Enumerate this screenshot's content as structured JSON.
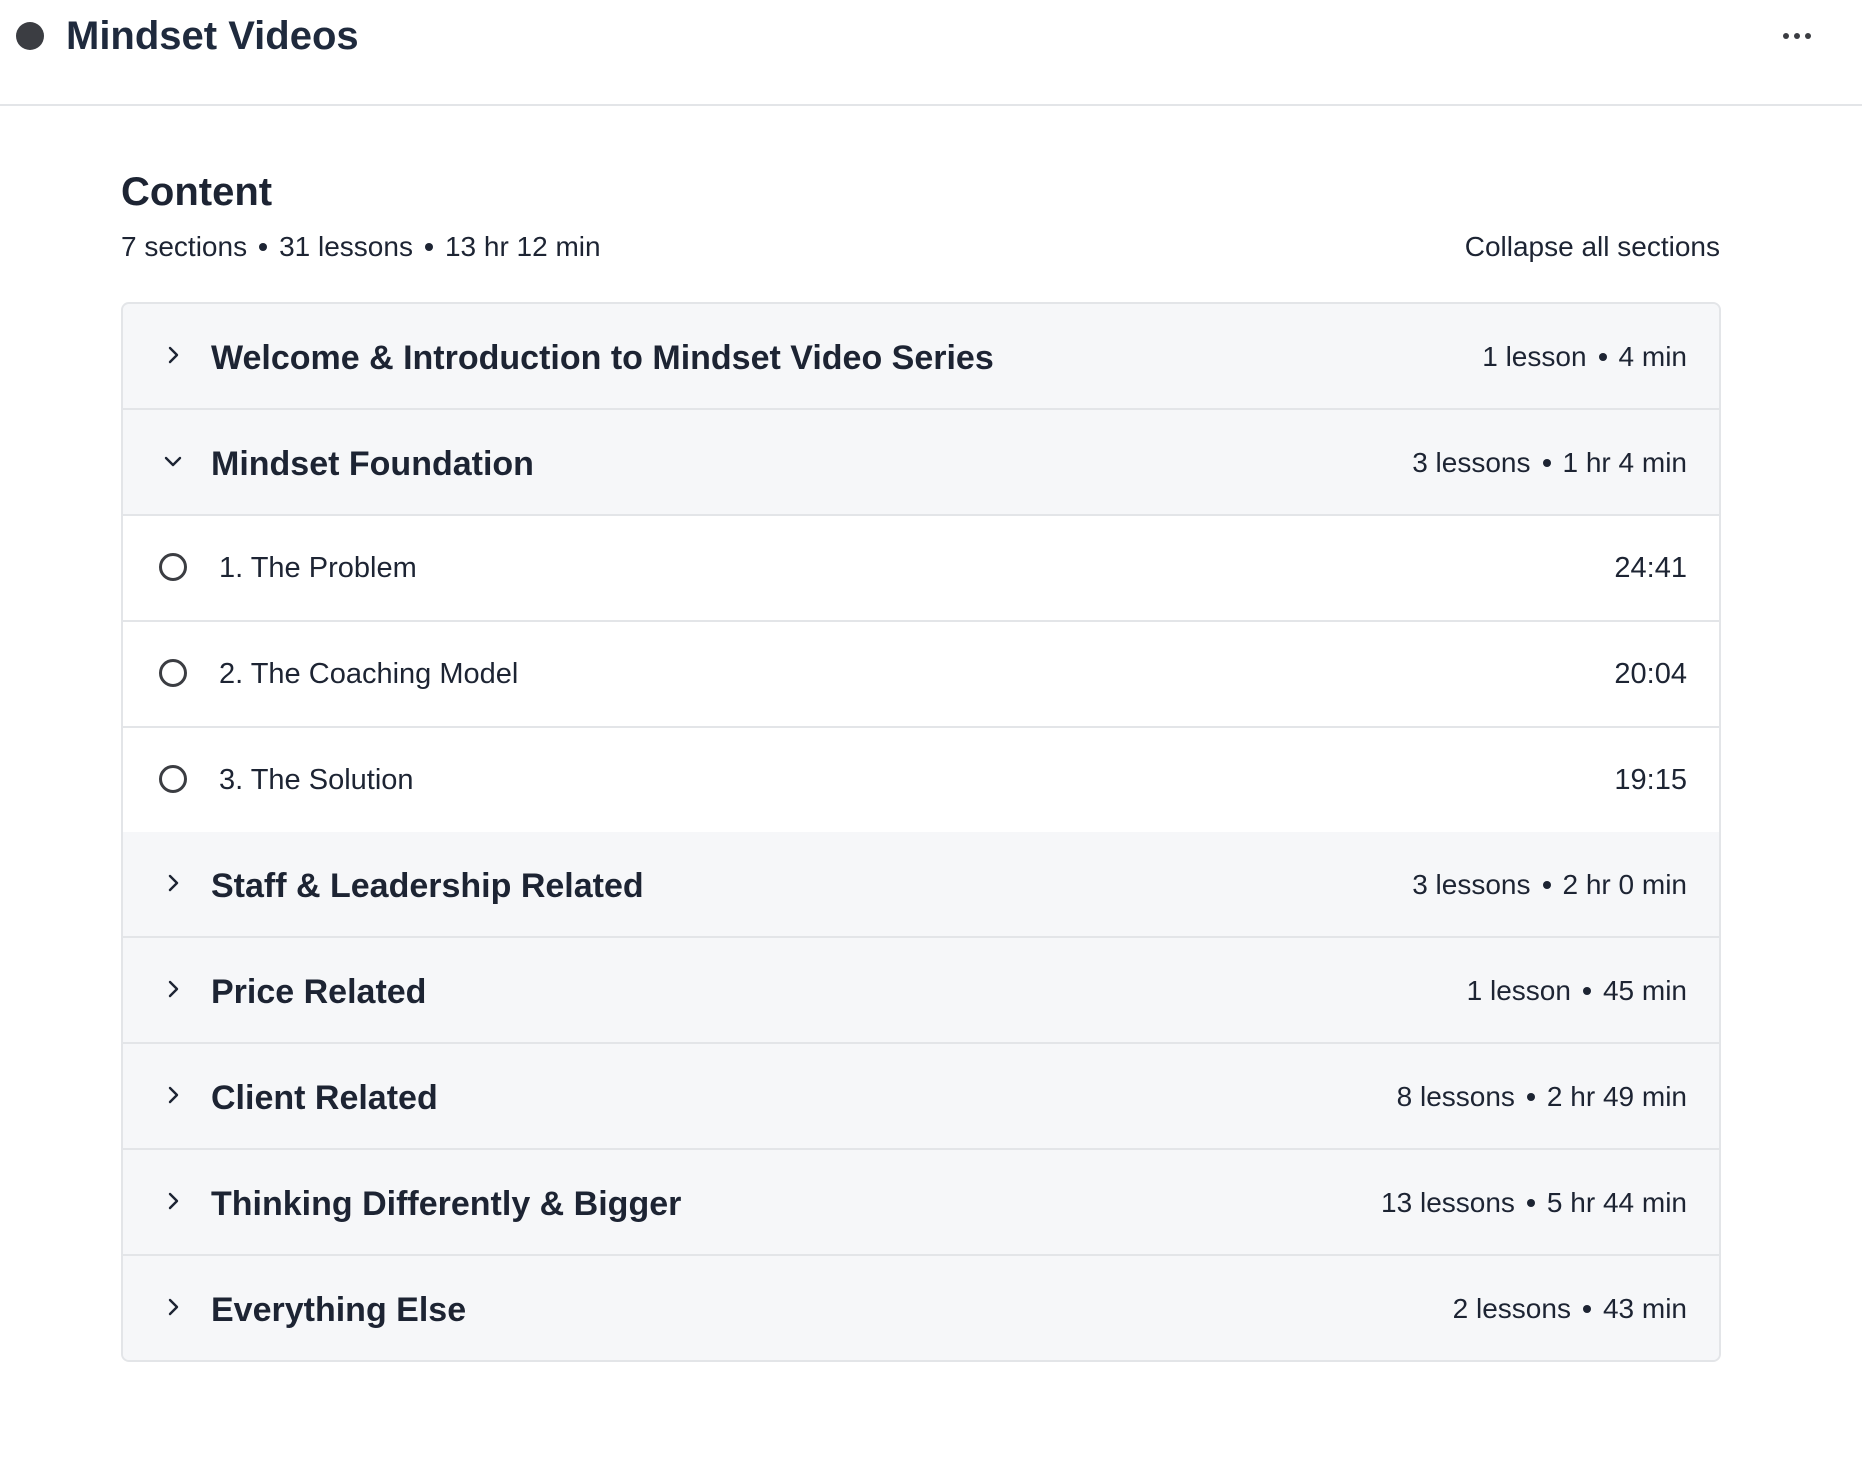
{
  "header": {
    "title": "Mindset Videos",
    "more_icon": "more-horizontal-icon"
  },
  "content": {
    "heading": "Content",
    "summary": {
      "sections": "7 sections",
      "lessons": "31 lessons",
      "duration": "13 hr 12 min"
    },
    "collapse_all_label": "Collapse all sections",
    "sections": [
      {
        "title": "Welcome & Introduction to Mindset Video Series",
        "lessons": "1 lesson",
        "duration": "4 min",
        "expanded": false
      },
      {
        "title": "Mindset Foundation",
        "lessons": "3 lessons",
        "duration": "1 hr 4 min",
        "expanded": true,
        "items": [
          {
            "title": "1. The Problem",
            "duration": "24:41"
          },
          {
            "title": "2. The Coaching Model",
            "duration": "20:04"
          },
          {
            "title": "3. The Solution",
            "duration": "19:15"
          }
        ]
      },
      {
        "title": "Staff & Leadership Related",
        "lessons": "3 lessons",
        "duration": "2 hr 0 min",
        "expanded": false
      },
      {
        "title": "Price Related",
        "lessons": "1 lesson",
        "duration": "45 min",
        "expanded": false
      },
      {
        "title": "Client Related",
        "lessons": "8 lessons",
        "duration": "2 hr 49 min",
        "expanded": false
      },
      {
        "title": "Thinking Differently & Bigger",
        "lessons": "13 lessons",
        "duration": "5 hr 44 min",
        "expanded": false
      },
      {
        "title": "Everything Else",
        "lessons": "2 lessons",
        "duration": "43 min",
        "expanded": false
      }
    ]
  }
}
